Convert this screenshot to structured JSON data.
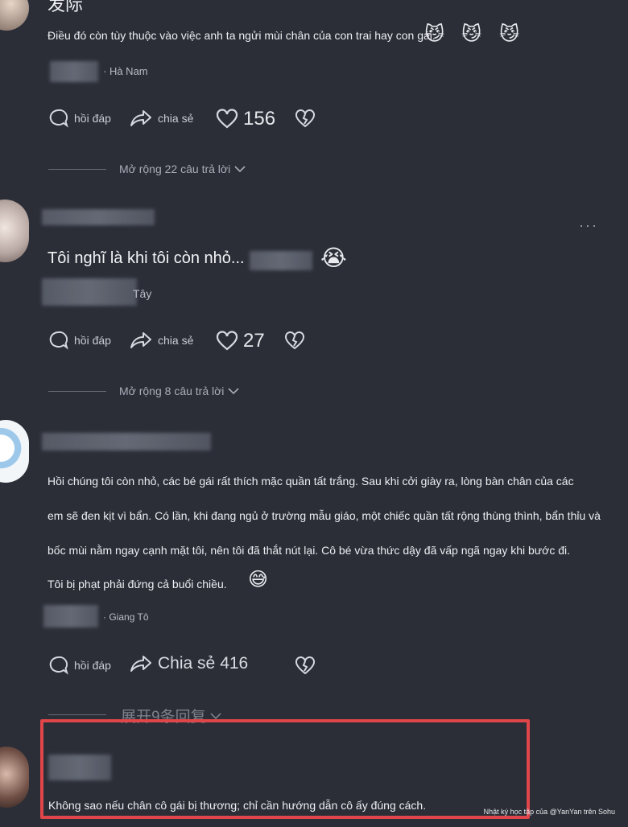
{
  "comments": [
    {
      "username": "发际",
      "text": "Điều đó còn tùy thuộc vào việc anh ta ngửi mùi chân của con trai hay con gái.",
      "location": "Hà Nam",
      "actions": {
        "reply": "hồi đáp",
        "share": "chia sẻ",
        "likes": "156"
      },
      "expand": "Mở rộng 22 câu trả lời"
    },
    {
      "text": "Tôi nghĩ là khi tôi còn nhỏ...",
      "location": "Tây",
      "actions": {
        "reply": "hồi đáp",
        "share": "chia sẻ",
        "likes": "27"
      },
      "expand": "Mở rộng 8 câu trả lời"
    },
    {
      "text_lines": [
        "Hồi chúng tôi còn nhỏ, các bé gái rất thích mặc quần tất trắng. Sau khi cởi giày ra, lòng bàn chân của các",
        "em sẽ đen kịt vì bẩn. Có lần, khi đang ngủ ở trường mẫu giáo, một chiếc quần tất rộng thùng thình, bẩn thỉu và",
        "bốc mùi nằm ngay cạnh mặt tôi, nên tôi đã thắt nút lại. Cô bé vừa thức dậy đã vấp ngã ngay khi bước đi.",
        "Tôi bị phạt phải đứng cả buổi chiều."
      ],
      "location": "Giang Tô",
      "actions": {
        "reply": "hồi đáp",
        "share": "Chia sẻ",
        "likes": "416"
      },
      "expand": "展开9条回复"
    },
    {
      "text": "Không sao nếu chân cô gái bị thương; chỉ cần hướng dẫn cô ấy đúng cách."
    }
  ],
  "more_menu": "···",
  "watermark": "Nhật ký học tập của @YanYan trên Sohu",
  "colors": {
    "background": "#2b2e37",
    "highlight": "#e0454a"
  }
}
